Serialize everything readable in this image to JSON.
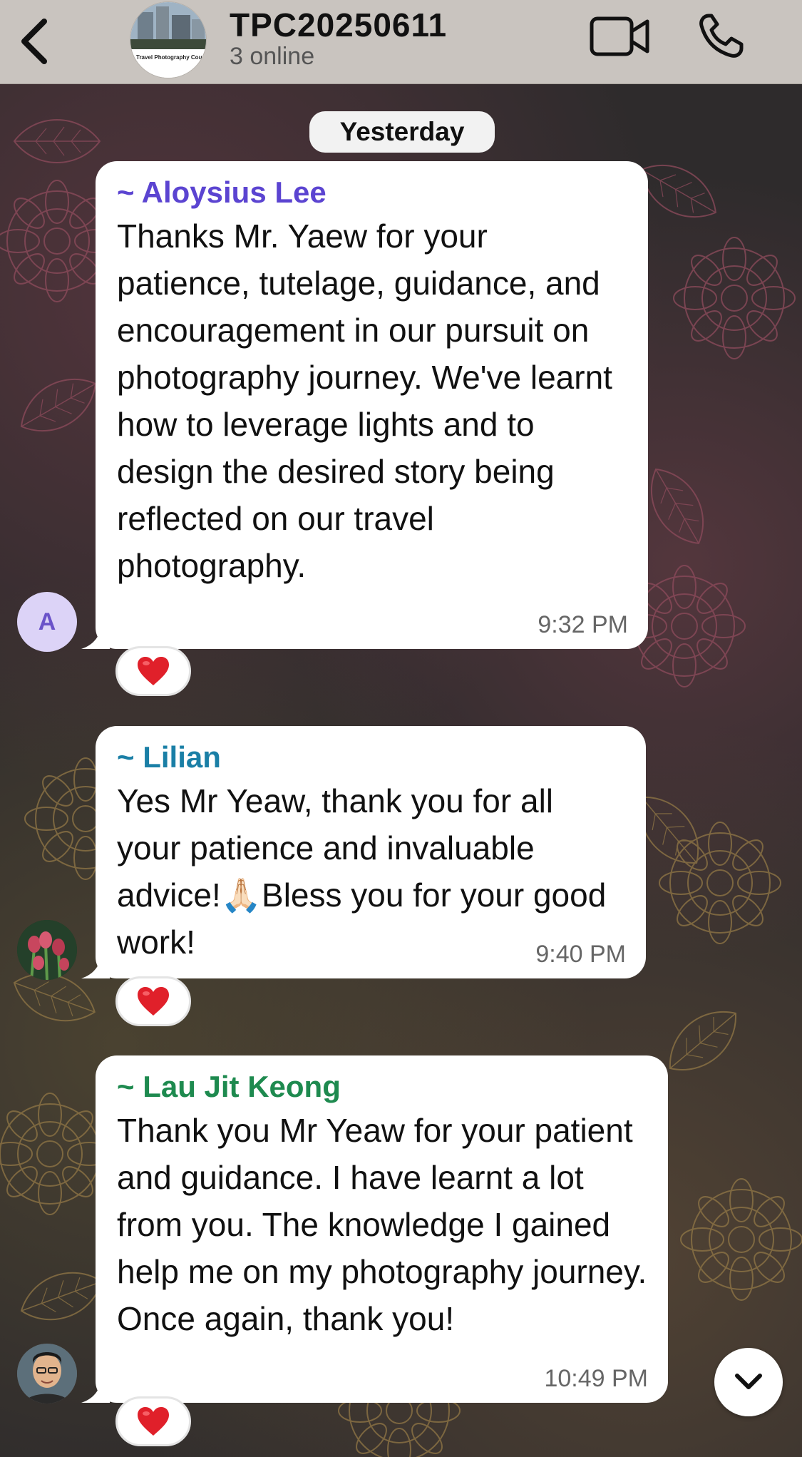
{
  "header": {
    "title": "TPC20250611",
    "subtitle": "3 online",
    "avatar_caption": "Travel Photography Course"
  },
  "date_separator": "Yesterday",
  "messages": [
    {
      "sender": "~ Aloysius Lee",
      "sender_color": "#5b44d1",
      "avatar_letter": "A",
      "text": "Thanks Mr. Yaew for your patience, tutelage,  guidance, and encouragement in our pursuit on photography journey. We've learnt how to leverage lights and to design the desired story being reflected on our travel photography.",
      "time": "9:32 PM",
      "reaction": "heart"
    },
    {
      "sender": "~ Lilian",
      "sender_color": "#1a7fa6",
      "text": "Yes Mr Yeaw, thank you for all your patience and invaluable advice!🙏🏻Bless you for your good work!",
      "time": "9:40 PM",
      "reaction": "heart"
    },
    {
      "sender": "~ Lau Jit Keong",
      "sender_color": "#1e8a4f",
      "text": "Thank you Mr Yeaw for your patient and guidance. I have learnt a lot from you. The knowledge I gained help me on my photography journey. Once again, thank you!",
      "time": "10:49 PM",
      "reaction": "heart"
    }
  ],
  "icons": {
    "back": "chevron-left-icon",
    "video": "video-camera-icon",
    "call": "phone-icon",
    "scroll": "chevron-down-icon",
    "reaction": "red-heart-icon"
  }
}
